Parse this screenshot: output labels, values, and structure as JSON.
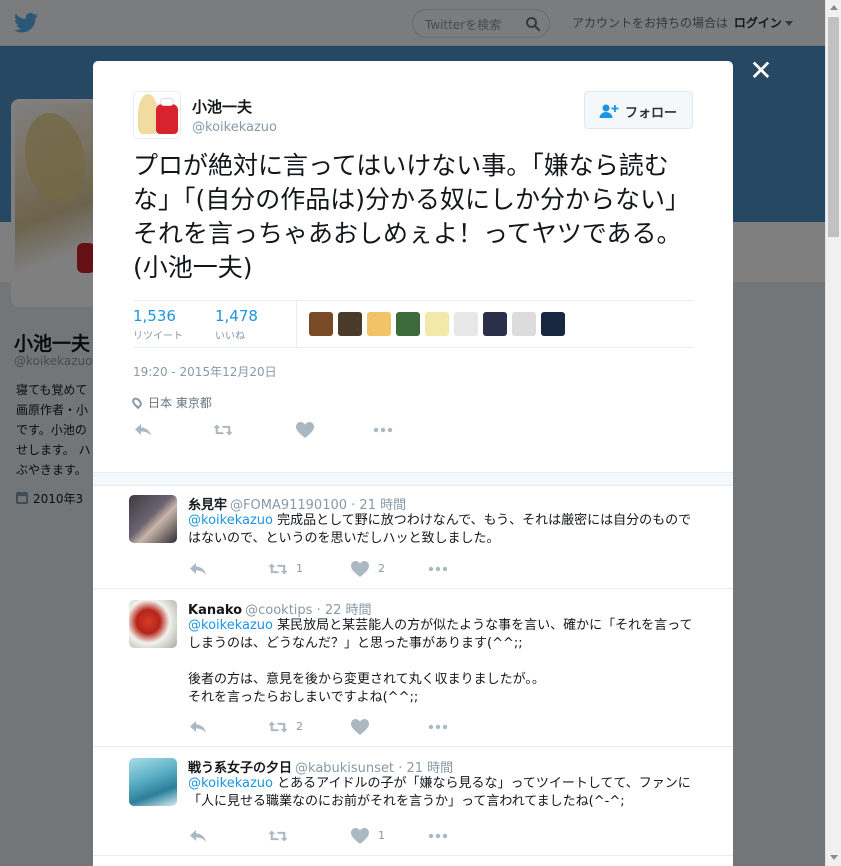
{
  "topbar": {
    "search_placeholder": "Twitterを検索",
    "login_prompt": "アカウントをお持ちの場合は",
    "login_label": "ログイン"
  },
  "profile": {
    "name": "小池一夫",
    "handle": "@koikekazuo",
    "bio_lines": [
      "寝ても覚めて",
      "画原作者・小",
      "です。小池の",
      "せします。 ハ",
      "ぶやきます。"
    ],
    "joined": "2010年3"
  },
  "tweet": {
    "author_name": "小池一夫",
    "author_handle": "@koikekazuo",
    "follow_label": "フォロー",
    "text": "プロが絶対に言ってはいけない事。「嫌なら読むな」「(自分の作品は)分かる奴にしか分からない」それを言っちゃあおしめぇよ！ってヤツである。(小池一夫)",
    "retweets": "1,536",
    "retweets_label": "リツイート",
    "likes": "1,478",
    "likes_label": "いいね",
    "liker_colors": [
      "#7a4a26",
      "#4a3a2a",
      "#f3c36a",
      "#3b6b3b",
      "#f2e9a8",
      "#e8e8e8",
      "#2b2f4a",
      "#dcdcdc",
      "#1a2740"
    ],
    "timestamp": "19:20 - 2015年12月20日",
    "location": "日本 東京都"
  },
  "replies": [
    {
      "name": "糸見牢",
      "handle": "@FOMA91190100",
      "time": "· 21 時間",
      "mention": "@koikekazuo",
      "text": " 完成品として野に放つわけなんで、もう、それは厳密には自分のものではないので、というのを思いだしハッと致しました。",
      "retweets": "1",
      "likes": "2"
    },
    {
      "name": "Kanako",
      "handle": "@cooktips",
      "time": "· 22 時間",
      "mention": "@koikekazuo",
      "text": " 某民放局と某芸能人の方が似たような事を言い、確かに「それを言ってしまうのは、どうなんだ？」と思った事があります(^^;;\n\n後者の方は、意見を後から変更されて丸く収まりましたが。。\nそれを言ったらおしまいですよね(^^;;",
      "retweets": "2",
      "likes": ""
    },
    {
      "name": "戦う系女子の夕日",
      "handle": "@kabukisunset",
      "time": "· 21 時間",
      "mention": "@koikekazuo",
      "text": " とあるアイドルの子が「嫌なら見るな」ってツイートしてて、ファンに「人に見せる職業なのにお前がそれを言うか」って言われてましたね(^-^;",
      "retweets": "",
      "likes": "1"
    }
  ]
}
